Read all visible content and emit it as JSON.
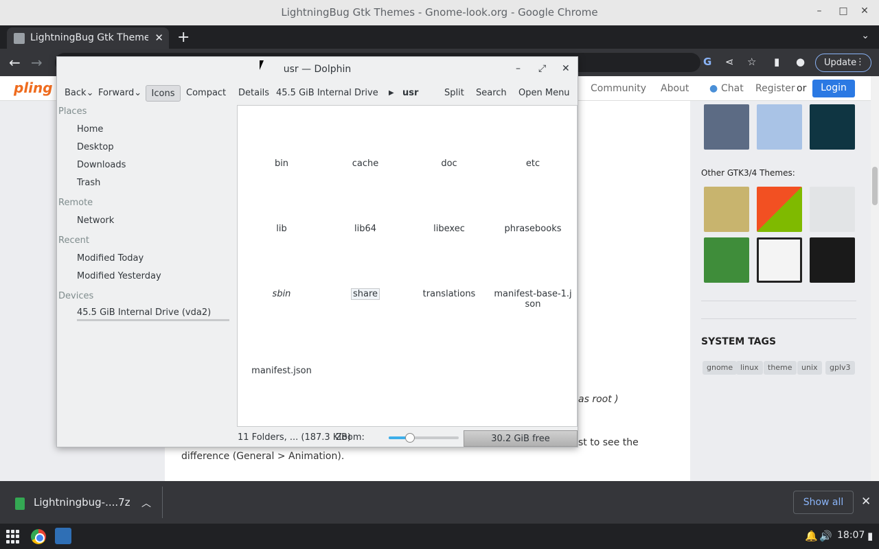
{
  "chrome": {
    "window_title": "LightningBug Gtk Themes - Gnome-look.org - Google Chrome",
    "tab_title": "LightningBug Gtk Themes",
    "update_label": "Update"
  },
  "site": {
    "logo": "pling",
    "nav": {
      "community": "Community",
      "about": "About",
      "chat": "Chat",
      "register": "Register",
      "or": "or",
      "login": "Login"
    },
    "content_fragment_1": "as root )",
    "content_fragment_2": "st to see the",
    "content_fragment_3": "difference (General > Animation).",
    "other_themes_title": "Other GTK3/4 Themes:",
    "system_tags_title": "SYSTEM TAGS",
    "tags": [
      "gnome",
      "linux",
      "theme",
      "unix",
      "gplv3"
    ]
  },
  "downloads": {
    "filename": "Lightningbug-....7z",
    "show_all": "Show all"
  },
  "taskbar": {
    "clock": "18:07"
  },
  "dolphin": {
    "title": "usr — Dolphin",
    "toolbar": {
      "back": "Back",
      "forward": "Forward",
      "icons": "Icons",
      "compact": "Compact",
      "details": "Details",
      "drive_crumb": "45.5 GiB Internal Drive (",
      "current_crumb": "usr",
      "split": "Split",
      "search": "Search",
      "open_menu": "Open Menu"
    },
    "places": {
      "places_header": "Places",
      "home": "Home",
      "desktop": "Desktop",
      "downloads": "Downloads",
      "trash": "Trash",
      "remote_header": "Remote",
      "network": "Network",
      "recent_header": "Recent",
      "modified_today": "Modified Today",
      "modified_yesterday": "Modified Yesterday",
      "devices_header": "Devices",
      "drive": "45.5 GiB Internal Drive (vda2)"
    },
    "files": [
      "bin",
      "cache",
      "doc",
      "etc",
      "lib",
      "lib64",
      "libexec",
      "phrasebooks",
      "sbin",
      "share",
      "translations",
      "manifest-base-1.json",
      "manifest.json"
    ],
    "status": "11 Folders, ... (187.3 KiB)",
    "zoom_label": "Zoom:",
    "zoom_level": 0.3,
    "free_space": "30.2 GiB free"
  }
}
